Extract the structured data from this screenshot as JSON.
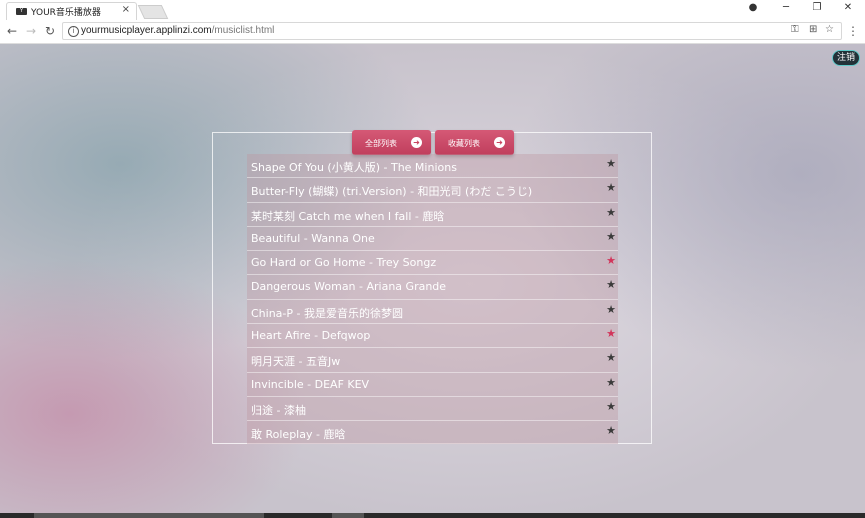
{
  "browser": {
    "tab_title": "YOUR音乐播放器",
    "favicon_text": "Y",
    "url_host": "yourmusicplayer.applinzi.com",
    "url_path": "/musiclist.html"
  },
  "icons": {
    "close": "×",
    "minimize": "─",
    "restore": "❐",
    "window_close": "✕",
    "back": "←",
    "forward": "→",
    "reload": "↻",
    "info": "i",
    "key": "⚿",
    "translate": "⊞",
    "bookmark": "☆",
    "menu": "⋮",
    "profile": "●",
    "arrow": "➜",
    "star": "★"
  },
  "colors": {
    "accent": "#c8445f",
    "star_default": "#3a3a3a",
    "star_favorite": "#d2345a"
  },
  "page": {
    "logout_label": "注销",
    "all_list_label": "全部列表",
    "fav_list_label": "收藏列表"
  },
  "songs": [
    {
      "title": "Shape Of You (小黄人版) - The Minions",
      "favorite": false
    },
    {
      "title": "Butter-Fly (蝴蝶) (tri.Version) - 和田光司 (わだ こうじ)",
      "favorite": false
    },
    {
      "title": "某时某刻 Catch me when I fall - 鹿晗",
      "favorite": false
    },
    {
      "title": "Beautiful - Wanna One",
      "favorite": false
    },
    {
      "title": "Go Hard or Go Home - Trey Songz",
      "favorite": true
    },
    {
      "title": "Dangerous Woman - Ariana Grande",
      "favorite": false
    },
    {
      "title": "China-P - 我是爱音乐的徐梦圆",
      "favorite": false
    },
    {
      "title": "Heart Afire - Defqwop",
      "favorite": true
    },
    {
      "title": "明月天涯 - 五音Jw",
      "favorite": false
    },
    {
      "title": "Invincible - DEAF KEV",
      "favorite": false
    },
    {
      "title": "归途 - 漆柚",
      "favorite": false
    },
    {
      "title": "敢 Roleplay - 鹿晗",
      "favorite": false
    }
  ]
}
